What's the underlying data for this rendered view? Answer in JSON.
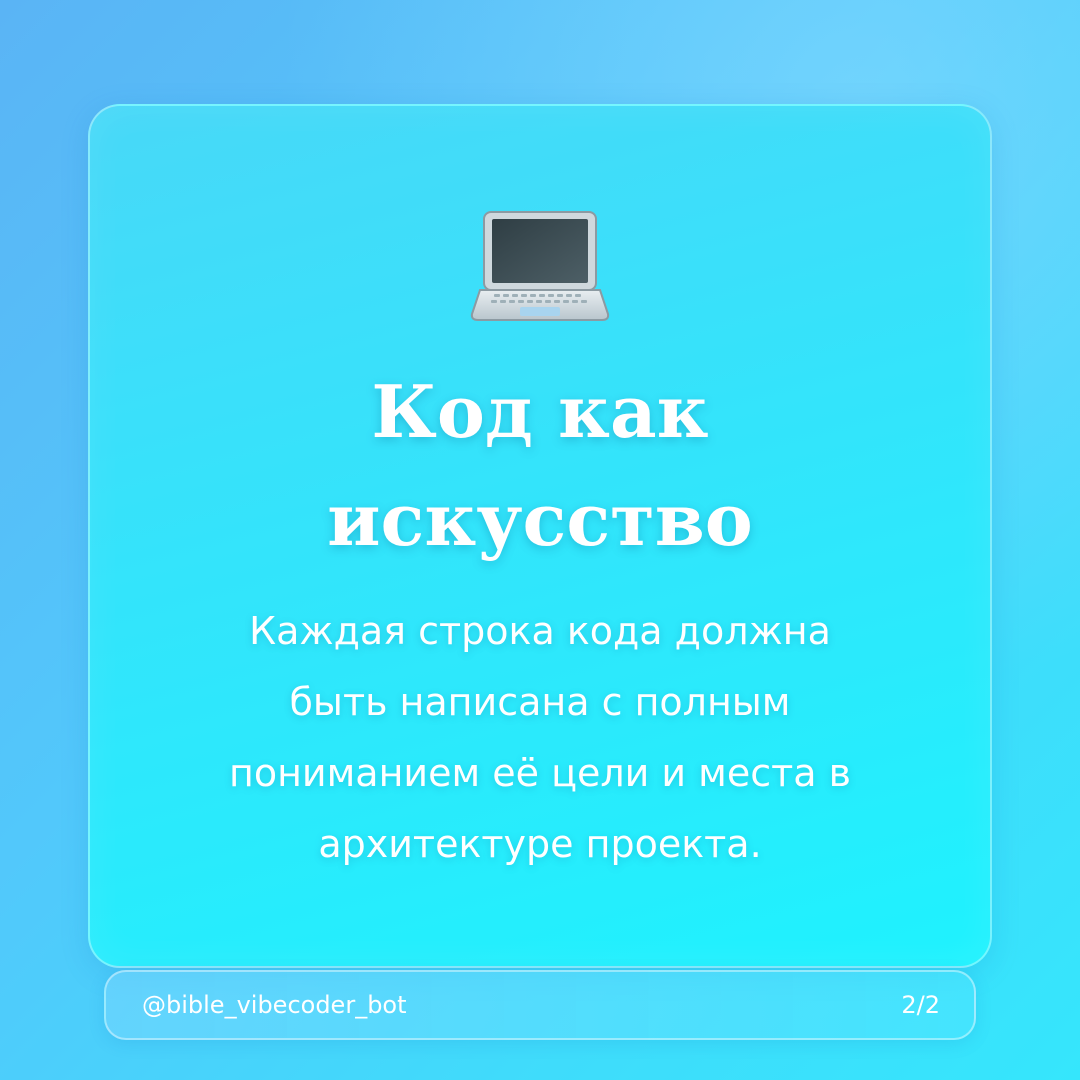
{
  "card": {
    "icon": "laptop-icon",
    "title_line1": "Код как",
    "title_line2": "искусство",
    "body_lines": [
      "Каждая строка кода должна",
      "быть написана с полным",
      "пониманием её цели и места в",
      "архитектуре проекта."
    ]
  },
  "footer": {
    "handle": "@bible_vibecoder_bot",
    "page": "2/2"
  },
  "colors": {
    "background_start": "#5ab4f5",
    "background_end": "#35e6fc",
    "card_top": "#48d8f8",
    "card_bottom": "#1ef2fe",
    "text": "#ffffff"
  }
}
